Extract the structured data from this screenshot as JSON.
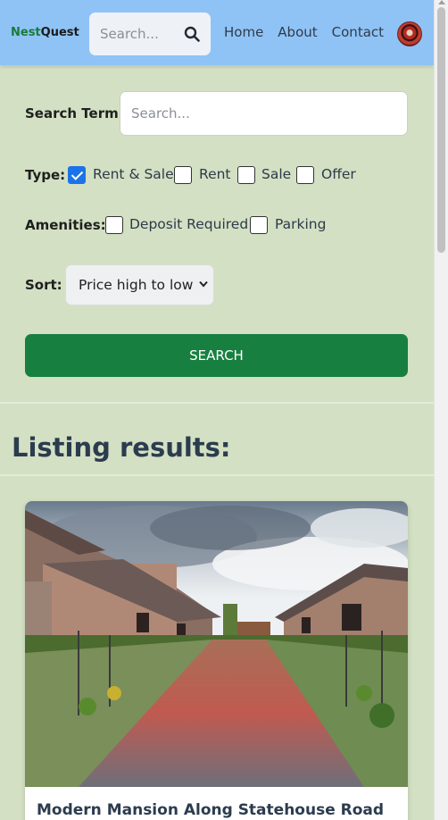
{
  "header": {
    "logo_part1": "Nest",
    "logo_part2": "Quest",
    "search_placeholder": "Search...",
    "nav": [
      "Home",
      "About",
      "Contact"
    ]
  },
  "form": {
    "search_term_label": "Search Term:",
    "search_term_placeholder": "Search...",
    "type_label": "Type:",
    "type_options": [
      {
        "label": "Rent & Sale",
        "checked": true
      },
      {
        "label": "Rent",
        "checked": false
      },
      {
        "label": "Sale",
        "checked": false
      },
      {
        "label": "Offer",
        "checked": false
      }
    ],
    "amenities_label": "Amenities:",
    "amenities_options": [
      {
        "label": "Deposit Required",
        "checked": false
      },
      {
        "label": "Parking",
        "checked": false
      }
    ],
    "sort_label": "Sort:",
    "sort_value": "Price high to low",
    "search_button": "SEARCH"
  },
  "results": {
    "title": "Listing results:",
    "listings": [
      {
        "title": "Modern Mansion Along Statehouse Road"
      }
    ]
  },
  "colors": {
    "header_bg": "#8fc3f5",
    "page_bg": "#d3e0c3",
    "primary_button": "#178040",
    "brand_green": "#1a7a3c"
  }
}
